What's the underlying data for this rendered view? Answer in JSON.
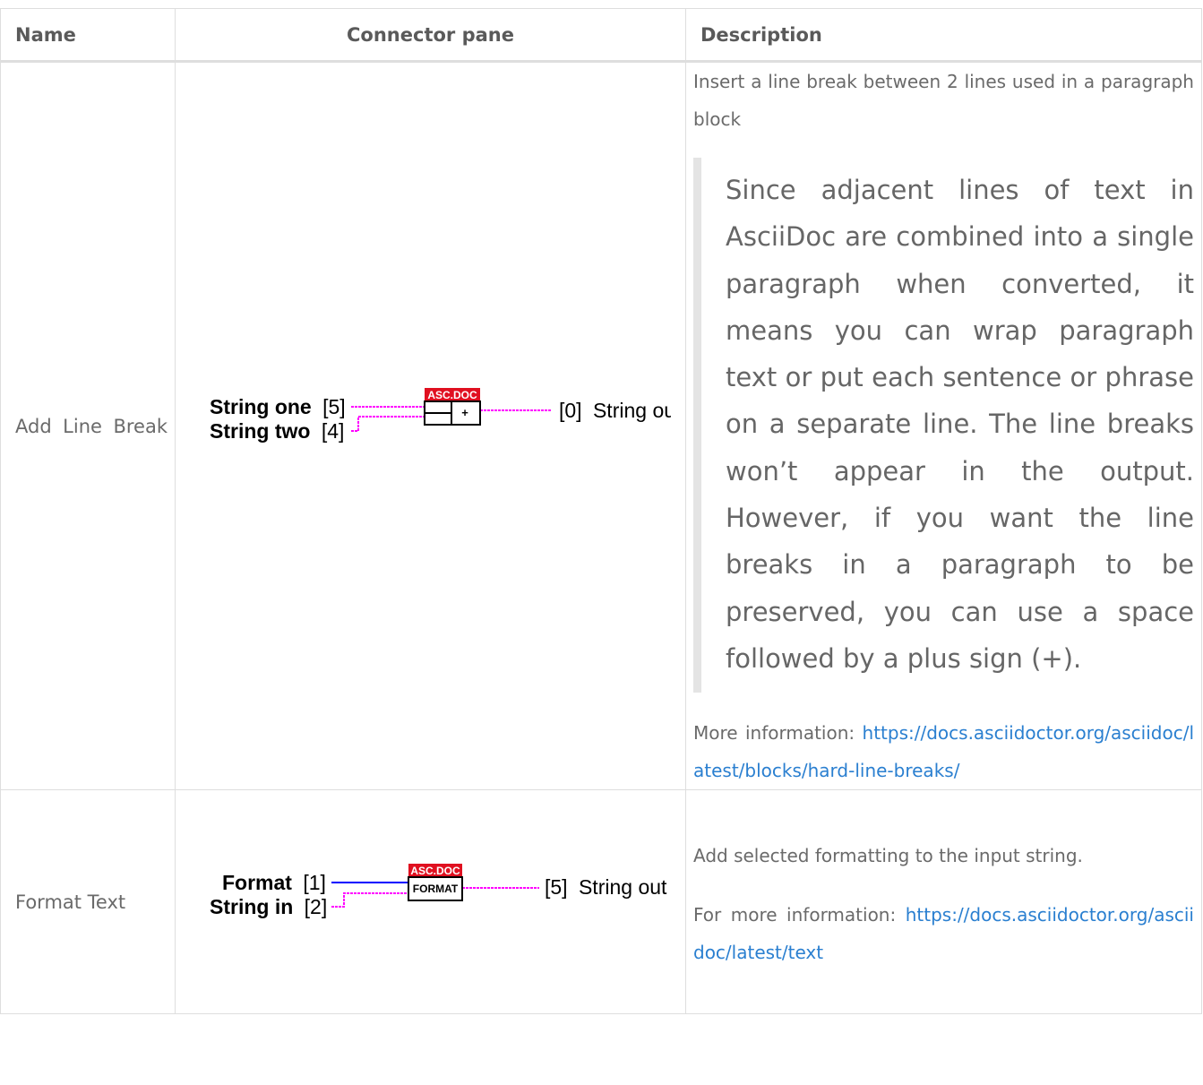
{
  "table": {
    "headers": {
      "name": "Name",
      "connector_pane": "Connector pane",
      "description": "Description"
    },
    "rows": [
      {
        "name": "Add Line Break",
        "connector": {
          "inputs": [
            {
              "label": "String one",
              "index": "[5]"
            },
            {
              "label": "String two",
              "index": "[4]"
            }
          ],
          "output": {
            "index": "[0]",
            "label": "String out"
          },
          "badge": "ASC.DOC",
          "glyph": "+"
        },
        "description": "Insert a line break between 2 lines used in a paragraph block",
        "quote": "Since adjacent lines of text in AsciiDoc are combined into a single paragraph when converted, it means you can wrap paragraph text or put each sentence or phrase on a separate line. The line breaks won’t appear in the output. However, if you want the line breaks in a paragraph to be preserved, you can use a space followed by a plus sign (+).",
        "more_label": "More information:",
        "link": "https://docs.asciidoctor.org/asciidoc/latest/blocks/hard-line-breaks/"
      },
      {
        "name": "Format Text",
        "connector": {
          "inputs": [
            {
              "label": "Format",
              "index": "[1]"
            },
            {
              "label": "String in",
              "index": "[2]"
            }
          ],
          "output": {
            "index": "[5]",
            "label": "String out"
          },
          "badge": "ASC.DOC",
          "glyph": "FORMAT"
        },
        "description": "Add selected formatting to the input string.",
        "more_label": "For more information:",
        "link": "https://docs.asciidoctor.org/asciidoc/latest/text"
      }
    ]
  },
  "colors": {
    "link": "#2a7fd0",
    "string_wire": "#ff00ff",
    "enum_wire": "#0000ff",
    "badge": "#e01020"
  }
}
